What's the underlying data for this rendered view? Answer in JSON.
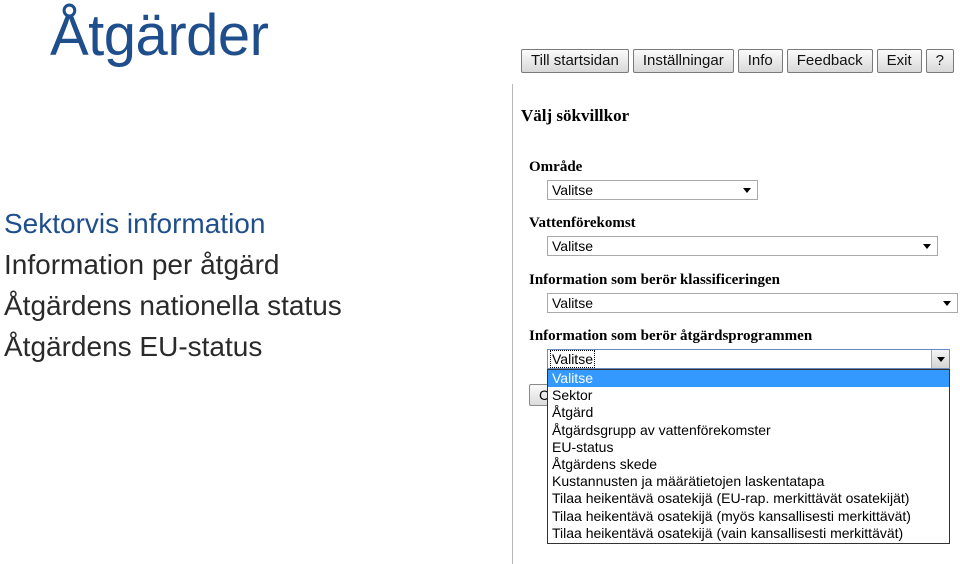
{
  "slide": {
    "title": "Åtgärder",
    "bullets": [
      "Sektorvis information",
      "Information per åtgärd",
      "Åtgärdens nationella status",
      "Åtgärdens EU-status"
    ]
  },
  "toolbar": {
    "buttons": [
      "Till startsidan",
      "Inställningar",
      "Info",
      "Feedback",
      "Exit",
      "?"
    ]
  },
  "panel": {
    "heading": "Välj sökvillkor",
    "fields": [
      {
        "label": "Område",
        "value": "Valitse"
      },
      {
        "label": "Vattenförekomst",
        "value": "Valitse"
      },
      {
        "label": "Information som berör klassificeringen",
        "value": "Valitse"
      },
      {
        "label": "Information som berör åtgärdsprogrammen",
        "value": "Valitse"
      }
    ],
    "hidden_button_label": "C",
    "dropdown_options": [
      "Valitse",
      "Sektor",
      "Åtgärd",
      "Åtgärdsgrupp av vattenförekomster",
      "EU-status",
      "Åtgärdens skede",
      "Kustannusten ja määrätietojen laskentatapa",
      "Tilaa heikentävä osatekijä (EU-rap. merkittävät osatekijät)",
      "Tilaa heikentävä osatekijä (myös kansallisesti merkittävät)",
      "Tilaa heikentävä osatekijä (vain kansallisesti merkittävät)"
    ],
    "dropdown_selected": "Valitse"
  },
  "colors": {
    "title": "#1f4e8c",
    "highlight": "#3399ff"
  }
}
